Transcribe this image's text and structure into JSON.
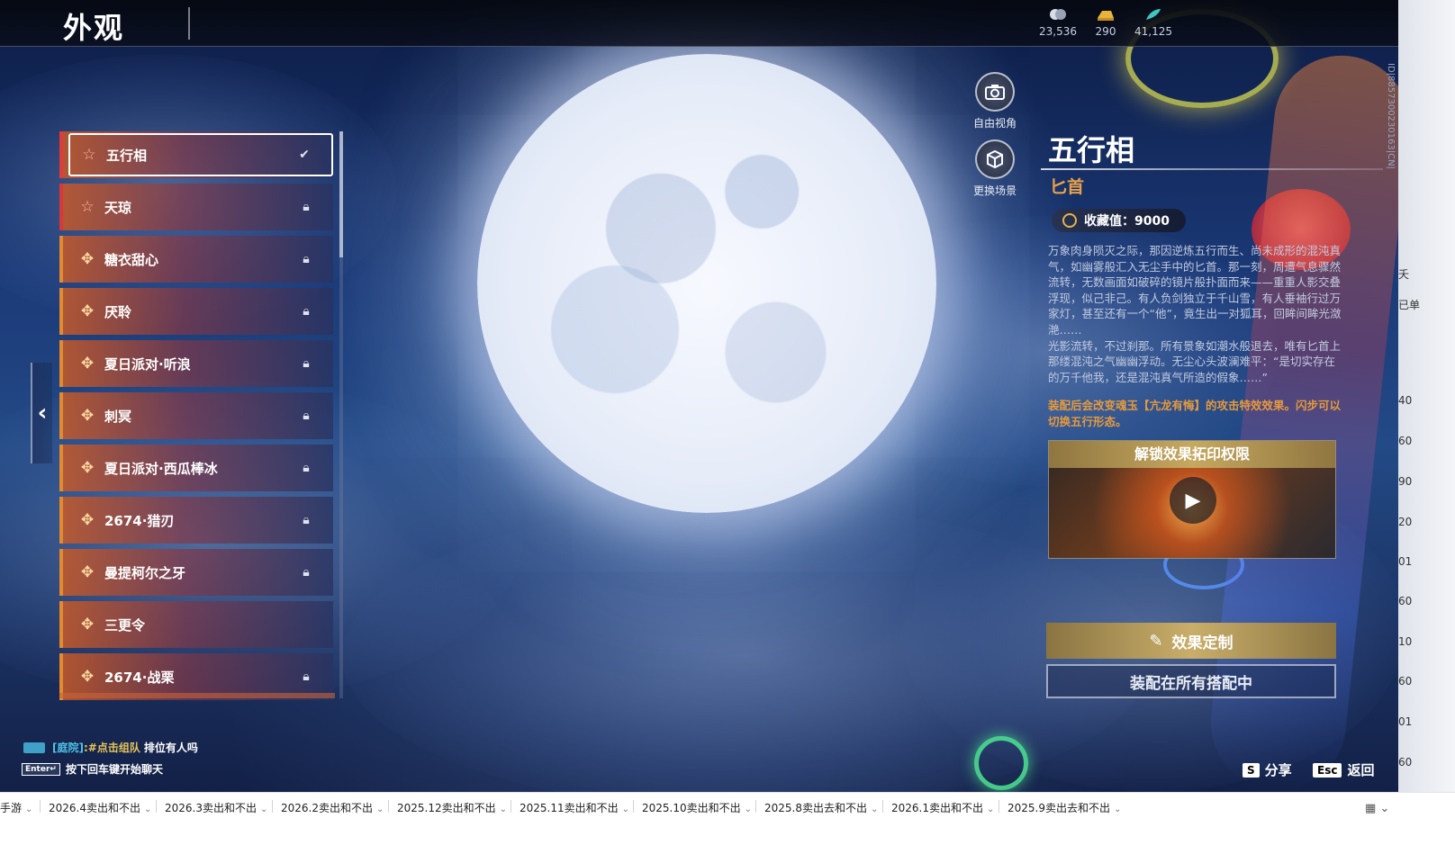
{
  "header": {
    "title": "外观",
    "currencies": [
      {
        "icon": "ticket-currency-icon",
        "amount": "23,536"
      },
      {
        "icon": "gold-ingot-icon",
        "amount": "290"
      },
      {
        "icon": "jade-feather-icon",
        "amount": "41,125"
      }
    ]
  },
  "skin_list": {
    "items": [
      {
        "name": "五行相",
        "icon": "star-icon",
        "status": "selected"
      },
      {
        "name": "天琼",
        "icon": "star-icon",
        "status": "locked"
      },
      {
        "name": "糖衣甜心",
        "icon": "pinwheel-icon",
        "status": "locked"
      },
      {
        "name": "厌聆",
        "icon": "pinwheel-icon",
        "status": "locked"
      },
      {
        "name": "夏日派对·听浪",
        "icon": "pinwheel-icon",
        "status": "locked"
      },
      {
        "name": "刺冥",
        "icon": "pinwheel-icon",
        "status": "locked"
      },
      {
        "name": "夏日派对·西瓜棒冰",
        "icon": "pinwheel-icon",
        "status": "locked"
      },
      {
        "name": "2674·猎刃",
        "icon": "pinwheel-icon",
        "status": "locked"
      },
      {
        "name": "曼提柯尔之牙",
        "icon": "pinwheel-icon",
        "status": "locked"
      },
      {
        "name": "三更令",
        "icon": "pinwheel-icon",
        "status": "unlocked"
      },
      {
        "name": "2674·战栗",
        "icon": "pinwheel-icon",
        "status": "locked"
      }
    ]
  },
  "scene_buttons": {
    "free_view": "自由视角",
    "change_scene": "更换场景"
  },
  "detail": {
    "title": "五行相",
    "weapon": "匕首",
    "collect_value": "收藏值：9000",
    "description_p1": "万象肉身陨灭之际，那因逆炼五行而生、尚未成形的混沌真气，如幽雾般汇入无尘手中的匕首。那一刻，周遭气息骤然流转，无数画面如破碎的镜片般扑面而来——重重人影交叠浮现，似己非己。有人负剑独立于千山雪，有人垂袖行过万家灯，甚至还有一个“他”，竟生出一对狐耳，回眸间眸光潋滟……",
    "description_p2": "光影流转，不过刹那。所有景象如潮水般退去，唯有匕首上那缕混沌之气幽幽浮动。无尘心头波澜难平：“是切实存在的万千他我，还是混沌真气所造的假象……”",
    "effect_note": "装配后会改变魂玉【亢龙有悔】的攻击特效效果。闪步可以切换五行形态。",
    "unlock_header": "解锁效果拓印权限",
    "customize_label": "效果定制",
    "equip_label": "装配在所有搭配中"
  },
  "version_id": "ID|8857300230163|CN|",
  "right_strip_ticks": [
    "夭",
    "已单",
    "40",
    "60",
    "90",
    "20",
    "01",
    "60",
    "10",
    "60",
    "01",
    "60"
  ],
  "chat": {
    "channel": "[庭院]",
    "message": ":#点击组队",
    "rest": "排位有人吗",
    "enter_key": "Enter↵",
    "hint": "按下回车键开始聊天"
  },
  "key_hints": {
    "share_key": "S",
    "share_label": "分享",
    "back_key": "Esc",
    "back_label": "返回"
  },
  "taskbar": {
    "tabs": [
      "手游",
      "2026.4卖出和不出",
      "2026.3卖出和不出",
      "2026.2卖出和不出",
      "2025.12卖出和不出",
      "2025.11卖出和不出",
      "2025.10卖出和不出",
      "2025.8卖出去和不出",
      "2026.1卖出和不出",
      "2025.9卖出去和不出"
    ]
  },
  "colors": {
    "accent_gold": "#c9ae6a",
    "weapon_orange": "#e7a24a",
    "effect_orange": "#e69a3c",
    "chat_cyan": "#4ec3e8",
    "chat_yellow": "#e6c45a"
  }
}
